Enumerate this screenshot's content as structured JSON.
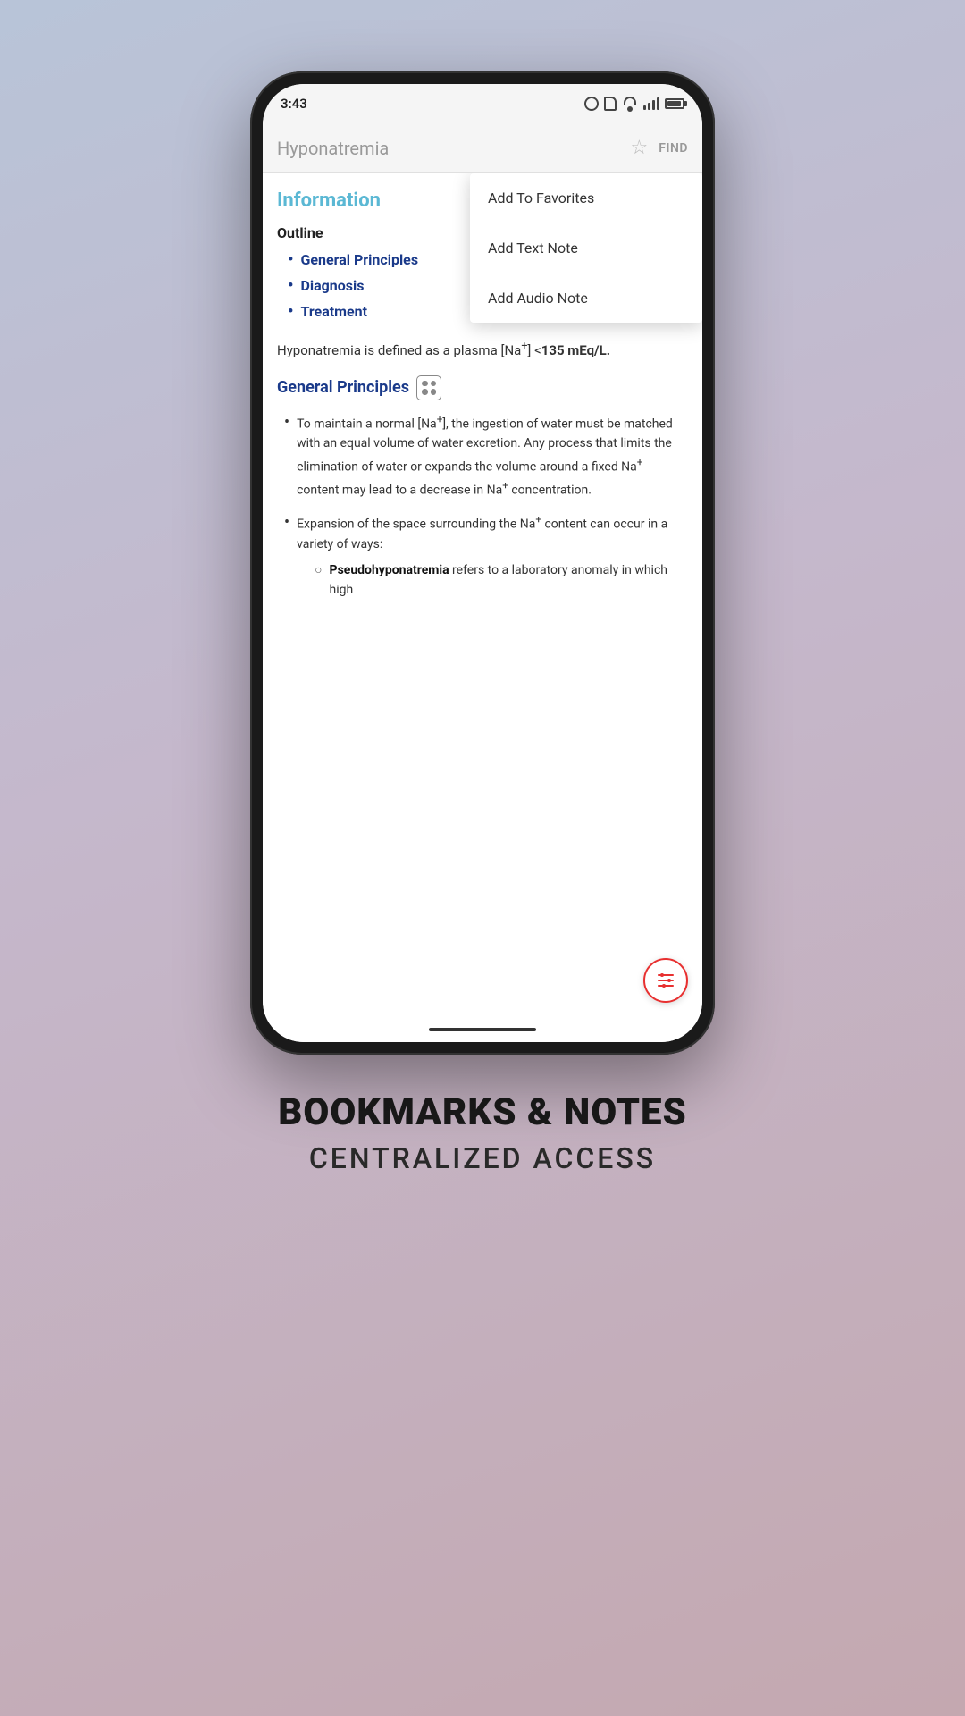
{
  "statusBar": {
    "time": "3:43",
    "icons": [
      "circle-icon",
      "sd-card-icon"
    ]
  },
  "header": {
    "title": "Hyponatremia",
    "starLabel": "☆",
    "findLabel": "FIND"
  },
  "content": {
    "sectionHeading": "Information",
    "outlineLabel": "Outline",
    "outlineItems": [
      "General Principles",
      "Diagnosis",
      "Treatment"
    ],
    "introText1": "Hyponatremia is defined as a plasma [Na",
    "introSup": "+",
    "introText2": "] <",
    "introBold": "135 mEq/L.",
    "subheading": "General Principles",
    "bulletPoints": [
      {
        "text": "To maintain a normal [Na",
        "sup": "+",
        "textCont": "], the ingestion of water must be matched with an equal volume of water excretion. Any process that limits the elimination of water or expands the volume around a fixed Na",
        "sup2": "+",
        "textCont2": " content may lead to a decrease in Na",
        "sup3": "+",
        "textCont3": " concentration."
      },
      {
        "text": "Expansion of the space surrounding the Na",
        "sup": "+",
        "textCont": " content can occur in a variety of ways:"
      }
    ],
    "subBulletPoints": [
      {
        "boldTerm": "Pseudohyponatremia",
        "text": " refers to a laboratory anomaly in which high"
      }
    ]
  },
  "dropdown": {
    "items": [
      "Add To Favorites",
      "Add Text Note",
      "Add Audio Note"
    ]
  },
  "bottomSection": {
    "title": "BOOKMARKS & NOTES",
    "subtitle": "Centralized Access"
  }
}
